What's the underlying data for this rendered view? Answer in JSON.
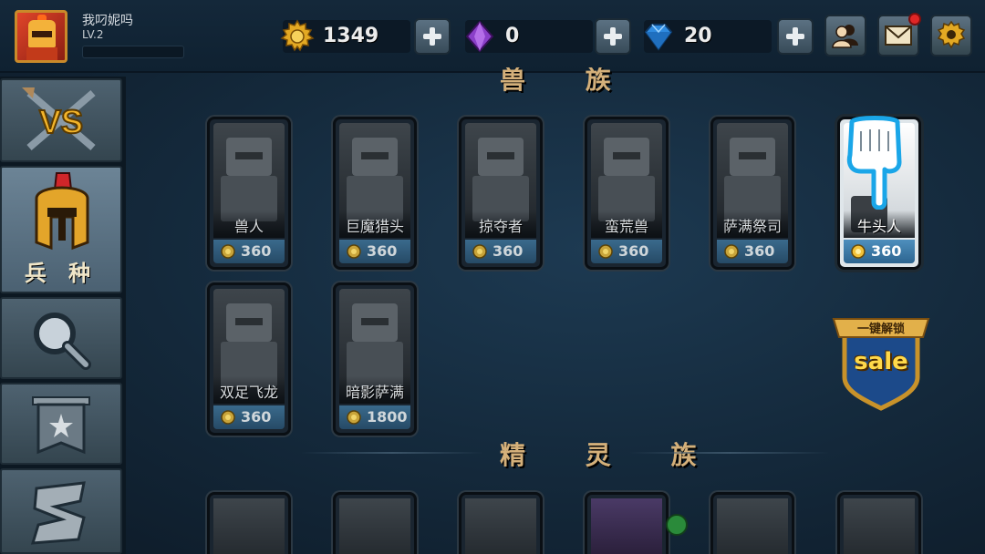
{
  "player": {
    "name": "我叼妮吗",
    "level": "LV.2"
  },
  "resources": [
    {
      "name": "gold",
      "value": "1349",
      "icon": "gold-gear-icon"
    },
    {
      "name": "purple_gem",
      "value": "0",
      "icon": "purple-gem-icon"
    },
    {
      "name": "diamond",
      "value": "20",
      "icon": "diamond-icon"
    }
  ],
  "top_buttons": [
    "friends-icon",
    "mail-icon",
    "settings-icon"
  ],
  "sidebar": {
    "items": [
      {
        "id": "vs",
        "icon": "vs-swords-icon"
      },
      {
        "id": "units",
        "icon": "helmet-icon",
        "label": "兵 种",
        "active": true
      },
      {
        "id": "search",
        "icon": "magnifier-icon"
      },
      {
        "id": "banner",
        "icon": "banner-icon"
      },
      {
        "id": "scroll",
        "icon": "scroll-icon"
      }
    ]
  },
  "sections": {
    "top_partial": "兽 族",
    "elves": "精 灵 族"
  },
  "units": [
    {
      "name": "兽人",
      "price": "360"
    },
    {
      "name": "巨魔猎头",
      "price": "360"
    },
    {
      "name": "掠夺者",
      "price": "360"
    },
    {
      "name": "蛮荒兽",
      "price": "360"
    },
    {
      "name": "萨满祭司",
      "price": "360"
    },
    {
      "name": "牛头人",
      "price": "360",
      "selected": true
    },
    {
      "name": "双足飞龙",
      "price": "360"
    },
    {
      "name": "暗影萨满",
      "price": "1800"
    }
  ],
  "sale_badge": {
    "top_label": "一键解锁",
    "text": "sale"
  },
  "colors": {
    "background": "#152b3e",
    "gold_text": "#d4b07a",
    "price_bar": "#3a6a8c"
  }
}
